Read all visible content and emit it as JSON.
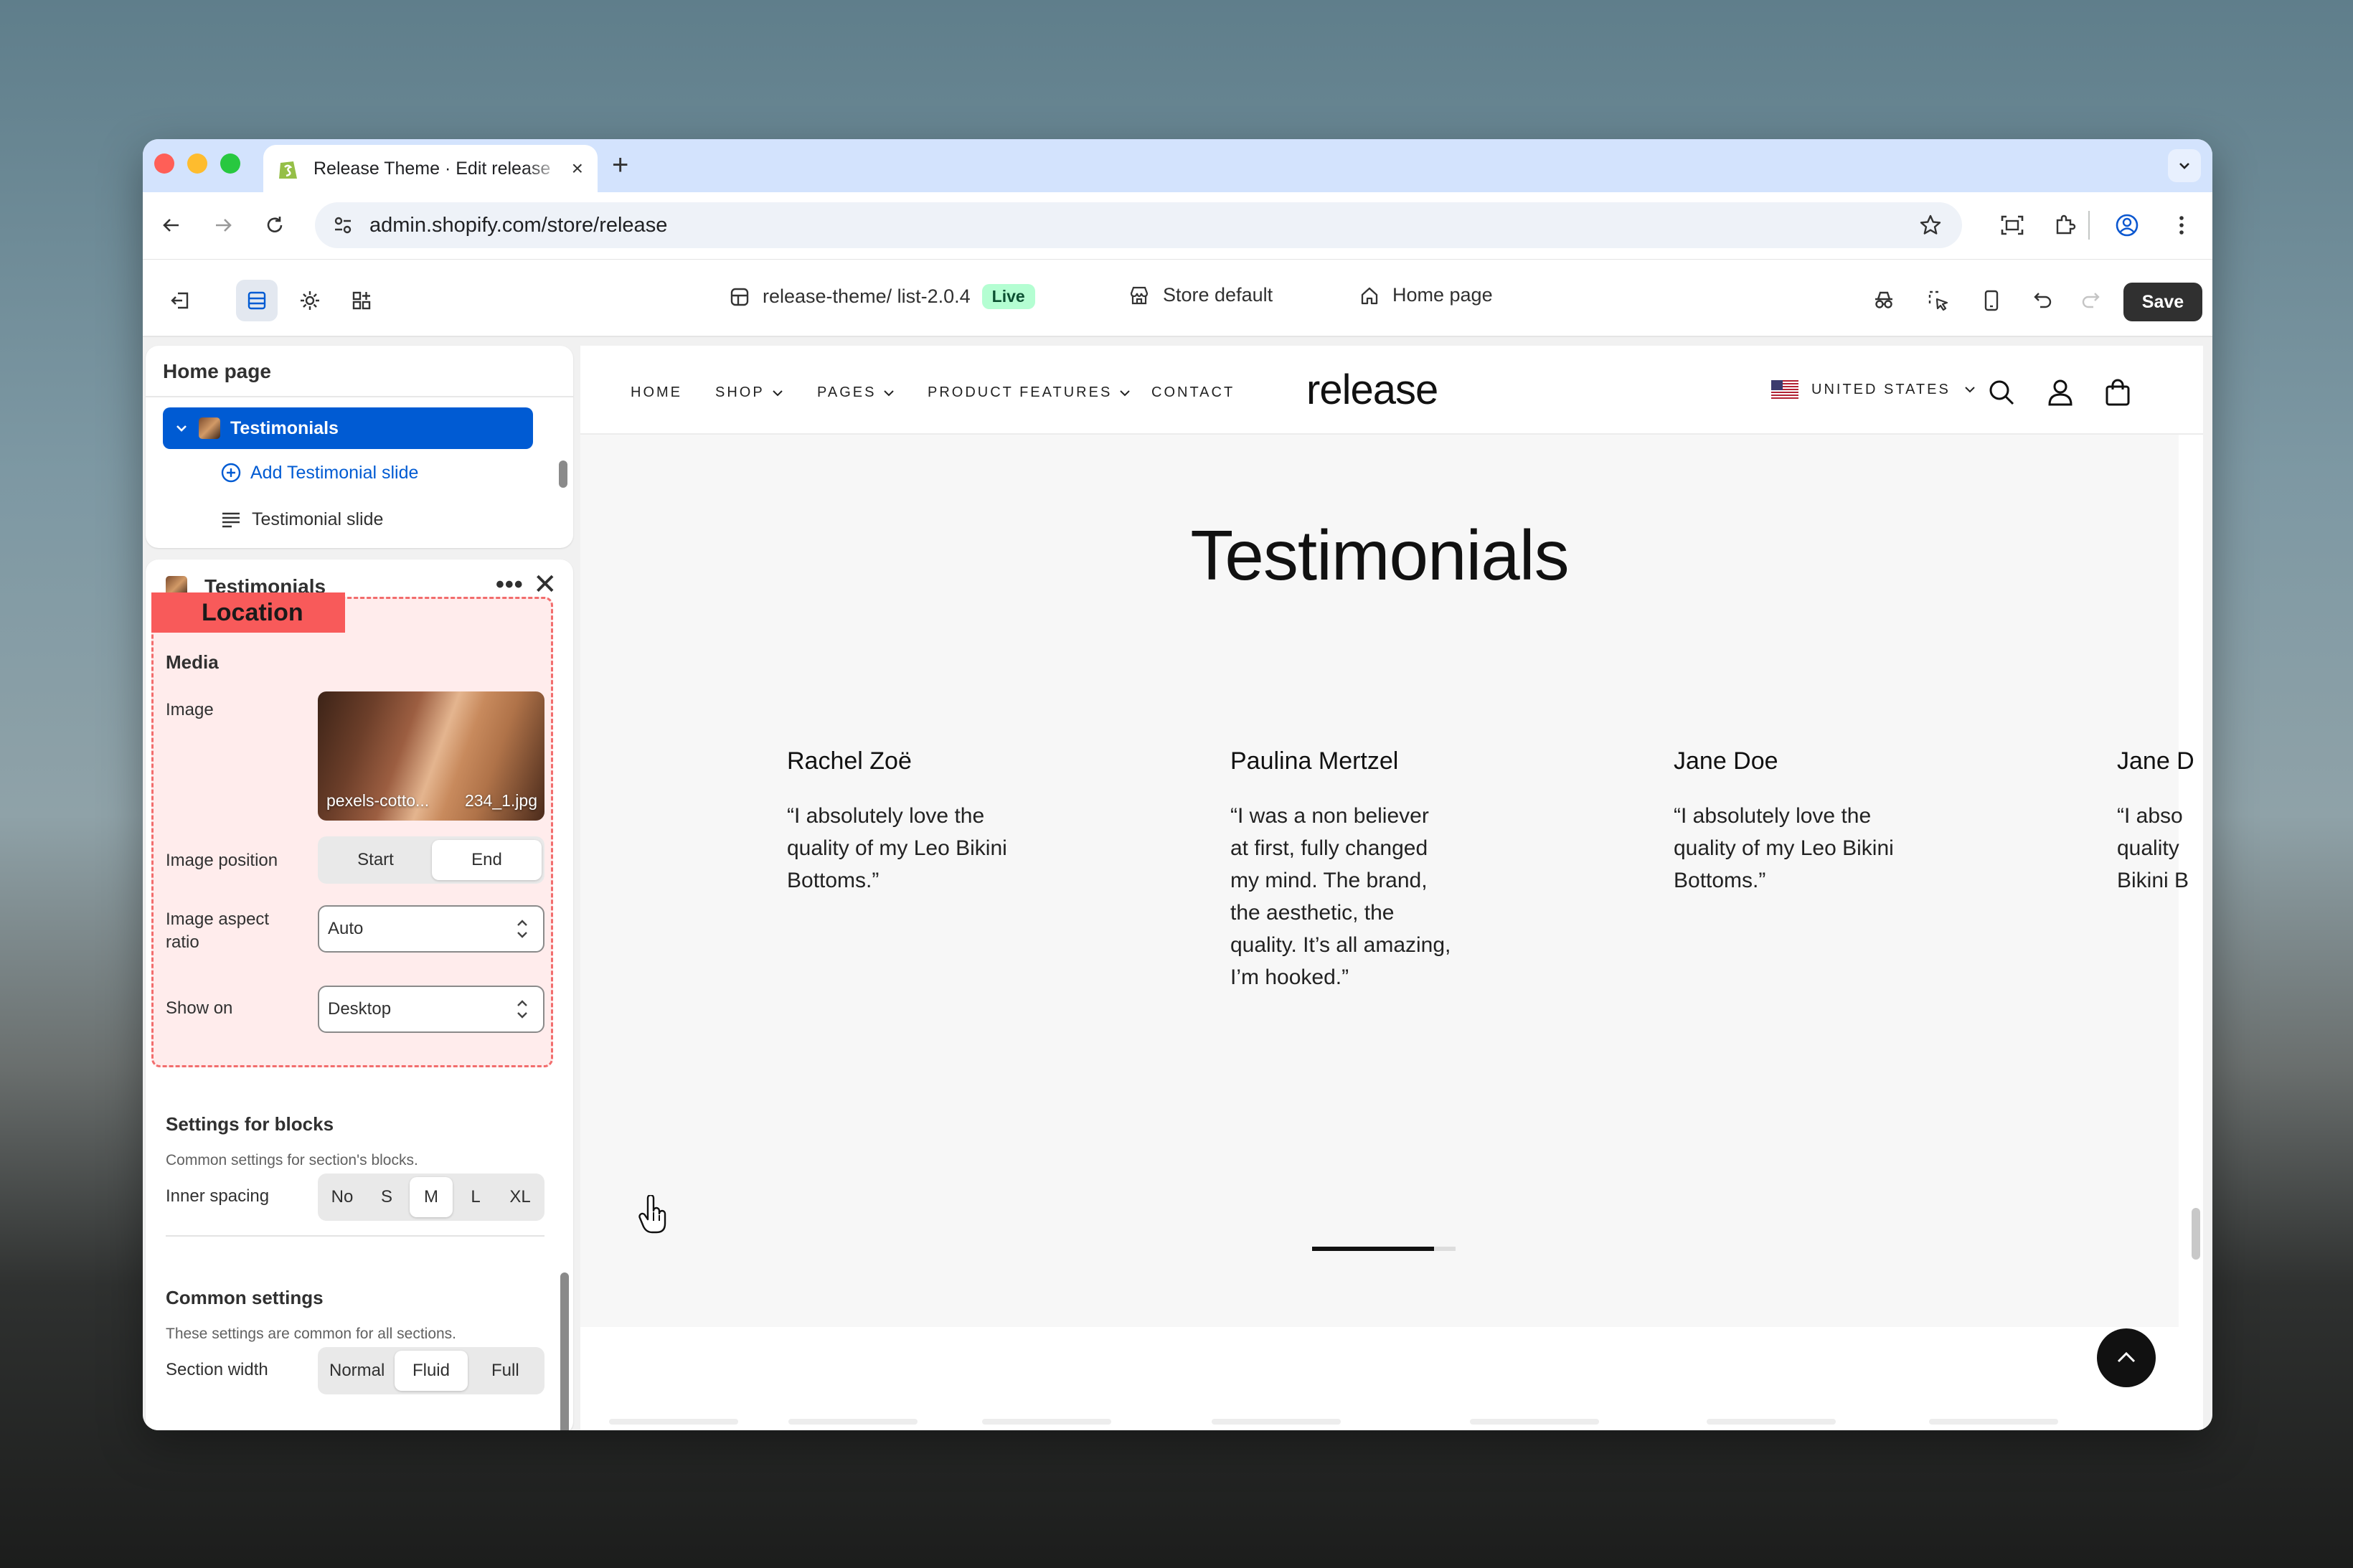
{
  "browser": {
    "tab_title": "Release Theme · Edit release",
    "tab_close": "×",
    "new_tab": "+",
    "url": "admin.shopify.com/store/release"
  },
  "toolbar": {
    "theme_name": "release-theme/ list-2.0.4",
    "live_badge": "Live",
    "store": "Store default",
    "page": "Home page",
    "save_label": "Save"
  },
  "sidebar": {
    "title": "Home page",
    "selected_section": "Testimonials",
    "add_block": "Add Testimonial slide",
    "block": "Testimonial slide"
  },
  "settings": {
    "section_title": "Testimonials",
    "more": "•••",
    "close": "✕",
    "annotation": "Location",
    "media_heading": "Media",
    "image_label": "Image",
    "image_file": "pexels-cotto...",
    "image_file_end": "234_1.jpg",
    "image_position_label": "Image position",
    "image_position_options": [
      "Start",
      "End"
    ],
    "image_position_selected": "End",
    "aspect_label": "Image aspect ratio",
    "aspect_value": "Auto",
    "show_on_label": "Show on",
    "show_on_value": "Desktop",
    "blocks_heading": "Settings for blocks",
    "blocks_sub": "Common settings for section's blocks.",
    "inner_spacing_label": "Inner spacing",
    "inner_spacing_options": [
      "No",
      "S",
      "M",
      "L",
      "XL"
    ],
    "inner_spacing_selected": "M",
    "common_heading": "Common settings",
    "common_sub": "These settings are common for all sections.",
    "section_width_label": "Section width",
    "section_width_options": [
      "Normal",
      "Fluid",
      "Full"
    ],
    "section_width_selected": "Fluid"
  },
  "store": {
    "nav": [
      "HOME",
      "SHOP",
      "PAGES",
      "PRODUCT FEATURES",
      "CONTACT"
    ],
    "logo": "release",
    "country": "UNITED STATES",
    "heading": "Testimonials",
    "testimonials": [
      {
        "name": "Rachel Zoë",
        "quote": "“I absolutely love the quality of my Leo Bikini Bottoms.”"
      },
      {
        "name": "Paulina Mertzel",
        "quote": "“I was a non believer at first, fully changed my mind. The brand, the aesthetic, the quality. It’s all amazing, I’m hooked.”"
      },
      {
        "name": "Jane Doe",
        "quote": "“I absolutely love the quality of my Leo Bikini Bottoms.”"
      },
      {
        "name": "Jane D",
        "quote": "“I abso quality Bikini B"
      }
    ],
    "carousel_progress": 0.85
  },
  "colors": {
    "accent": "#005bd3",
    "live_bg": "#b4fed2",
    "annotation": "#f85a5a"
  }
}
